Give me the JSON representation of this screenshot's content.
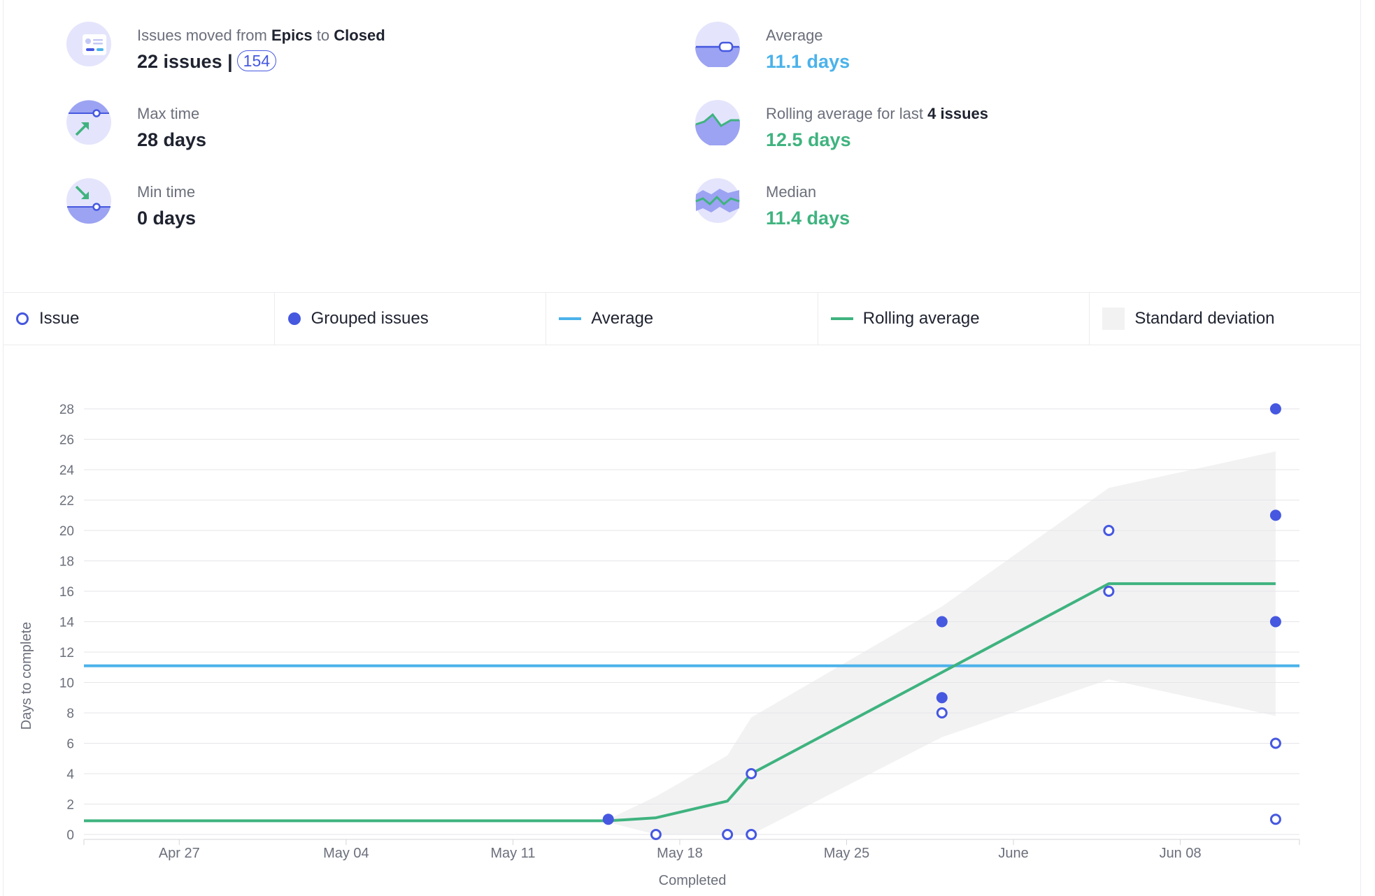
{
  "stats": {
    "moved": {
      "prefix": "Issues moved from",
      "from": "Epics",
      "to_word": "to",
      "to": "Closed",
      "value": "22 issues |",
      "count": "154"
    },
    "max": {
      "label": "Max time",
      "value": "28 days"
    },
    "min": {
      "label": "Min time",
      "value": "0 days"
    },
    "average": {
      "label": "Average",
      "value": "11.1 days"
    },
    "rolling": {
      "label_prefix": "Rolling average for last",
      "label_bold": "4 issues",
      "value": "12.5 days"
    },
    "median": {
      "label": "Median",
      "value": "11.4 days"
    }
  },
  "legend": {
    "issue": "Issue",
    "grouped": "Grouped issues",
    "average": "Average",
    "rolling": "Rolling average",
    "stddev": "Standard deviation"
  },
  "colors": {
    "issue": "#4658e0",
    "average": "#4bb2ea",
    "rolling": "#3fb37f",
    "stddev": "#f2f2f3",
    "grid": "#e6e6e9"
  },
  "chart_data": {
    "type": "scatter",
    "xlabel": "Completed",
    "ylabel": "Days to complete",
    "ylim": [
      0,
      28
    ],
    "yticks": [
      0,
      2,
      4,
      6,
      8,
      10,
      12,
      14,
      16,
      18,
      20,
      22,
      24,
      26,
      28
    ],
    "xlim": [
      "2020-04-22",
      "2020-06-12"
    ],
    "xticks": [
      {
        "date": "2020-04-26",
        "label": "Apr 27"
      },
      {
        "date": "2020-05-03",
        "label": "May 04"
      },
      {
        "date": "2020-05-10",
        "label": "May 11"
      },
      {
        "date": "2020-05-17",
        "label": "May 18"
      },
      {
        "date": "2020-05-24",
        "label": "May 25"
      },
      {
        "date": "2020-05-31",
        "label": "June"
      },
      {
        "date": "2020-06-07",
        "label": "Jun 08"
      }
    ],
    "grid": true,
    "average": 11.1,
    "issues": [
      {
        "date": "2020-05-16",
        "days": 0
      },
      {
        "date": "2020-05-19",
        "days": 0
      },
      {
        "date": "2020-05-20",
        "days": 0
      },
      {
        "date": "2020-05-20",
        "days": 4
      },
      {
        "date": "2020-05-28",
        "days": 8
      },
      {
        "date": "2020-06-04",
        "days": 20
      },
      {
        "date": "2020-06-04",
        "days": 16
      },
      {
        "date": "2020-06-11",
        "days": 6
      },
      {
        "date": "2020-06-11",
        "days": 1
      }
    ],
    "grouped": [
      {
        "date": "2020-05-14",
        "days": 1
      },
      {
        "date": "2020-05-28",
        "days": 14
      },
      {
        "date": "2020-05-28",
        "days": 9
      },
      {
        "date": "2020-06-11",
        "days": 28
      },
      {
        "date": "2020-06-11",
        "days": 21
      },
      {
        "date": "2020-06-11",
        "days": 14
      }
    ],
    "rolling_average": [
      {
        "date": "2020-04-22",
        "days": 0.9
      },
      {
        "date": "2020-05-14",
        "days": 0.9
      },
      {
        "date": "2020-05-16",
        "days": 1.1
      },
      {
        "date": "2020-05-19",
        "days": 2.2
      },
      {
        "date": "2020-05-20",
        "days": 4
      },
      {
        "date": "2020-06-04",
        "days": 16.5
      },
      {
        "date": "2020-06-11",
        "days": 16.5
      }
    ],
    "stddev_upper": [
      {
        "date": "2020-05-14",
        "days": 1
      },
      {
        "date": "2020-05-16",
        "days": 2.5
      },
      {
        "date": "2020-05-19",
        "days": 5.2
      },
      {
        "date": "2020-05-20",
        "days": 7.7
      },
      {
        "date": "2020-05-28",
        "days": 15
      },
      {
        "date": "2020-06-04",
        "days": 22.8
      },
      {
        "date": "2020-06-11",
        "days": 25.2
      }
    ],
    "stddev_lower": [
      {
        "date": "2020-05-14",
        "days": 0.8
      },
      {
        "date": "2020-05-16",
        "days": 0
      },
      {
        "date": "2020-05-20",
        "days": 0
      },
      {
        "date": "2020-05-28",
        "days": 6.4
      },
      {
        "date": "2020-06-04",
        "days": 10.2
      },
      {
        "date": "2020-06-11",
        "days": 7.8
      }
    ]
  }
}
